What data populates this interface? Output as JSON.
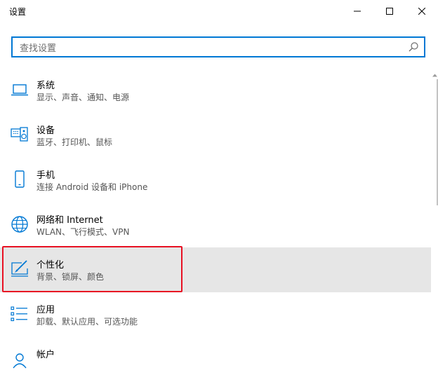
{
  "window": {
    "title": "设置"
  },
  "search": {
    "placeholder": "查找设置"
  },
  "items": [
    {
      "name": "系统",
      "desc": "显示、声音、通知、电源",
      "icon": "laptop-icon"
    },
    {
      "name": "设备",
      "desc": "蓝牙、打印机、鼠标",
      "icon": "keyboard-speaker-icon"
    },
    {
      "name": "手机",
      "desc": "连接 Android 设备和 iPhone",
      "icon": "phone-icon"
    },
    {
      "name": "网络和 Internet",
      "desc": "WLAN、飞行模式、VPN",
      "icon": "globe-icon"
    },
    {
      "name": "个性化",
      "desc": "背景、锁屏、颜色",
      "icon": "paintbrush-screen-icon",
      "selected": true
    },
    {
      "name": "应用",
      "desc": "卸载、默认应用、可选功能",
      "icon": "apps-list-icon"
    },
    {
      "name": "帐户",
      "desc": "",
      "icon": "person-icon"
    }
  ],
  "colors": {
    "accent": "#0078d4",
    "selected_bg": "#e6e6e6",
    "highlight": "#e81123"
  }
}
